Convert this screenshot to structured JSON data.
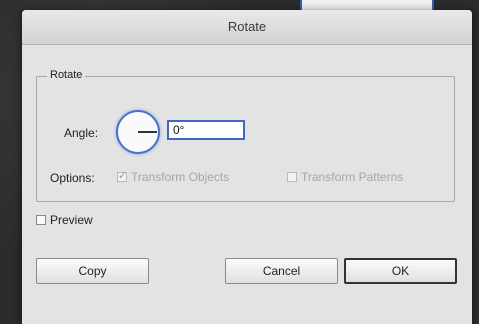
{
  "dialog": {
    "title": "Rotate",
    "group_label": "Rotate",
    "angle_label": "Angle:",
    "angle_value": "0°",
    "options_label": "Options:",
    "transform_objects": {
      "label": "Transform Objects",
      "checked": true,
      "enabled": false
    },
    "transform_patterns": {
      "label": "Transform Patterns",
      "checked": false,
      "enabled": false
    },
    "preview": {
      "label": "Preview",
      "checked": false
    },
    "buttons": {
      "copy": "Copy",
      "cancel": "Cancel",
      "ok": "OK"
    }
  },
  "colors": {
    "focus_blue": "#3f67c5",
    "dialog_bg": "#e3e3e3",
    "backdrop": "#2c2c2c"
  }
}
